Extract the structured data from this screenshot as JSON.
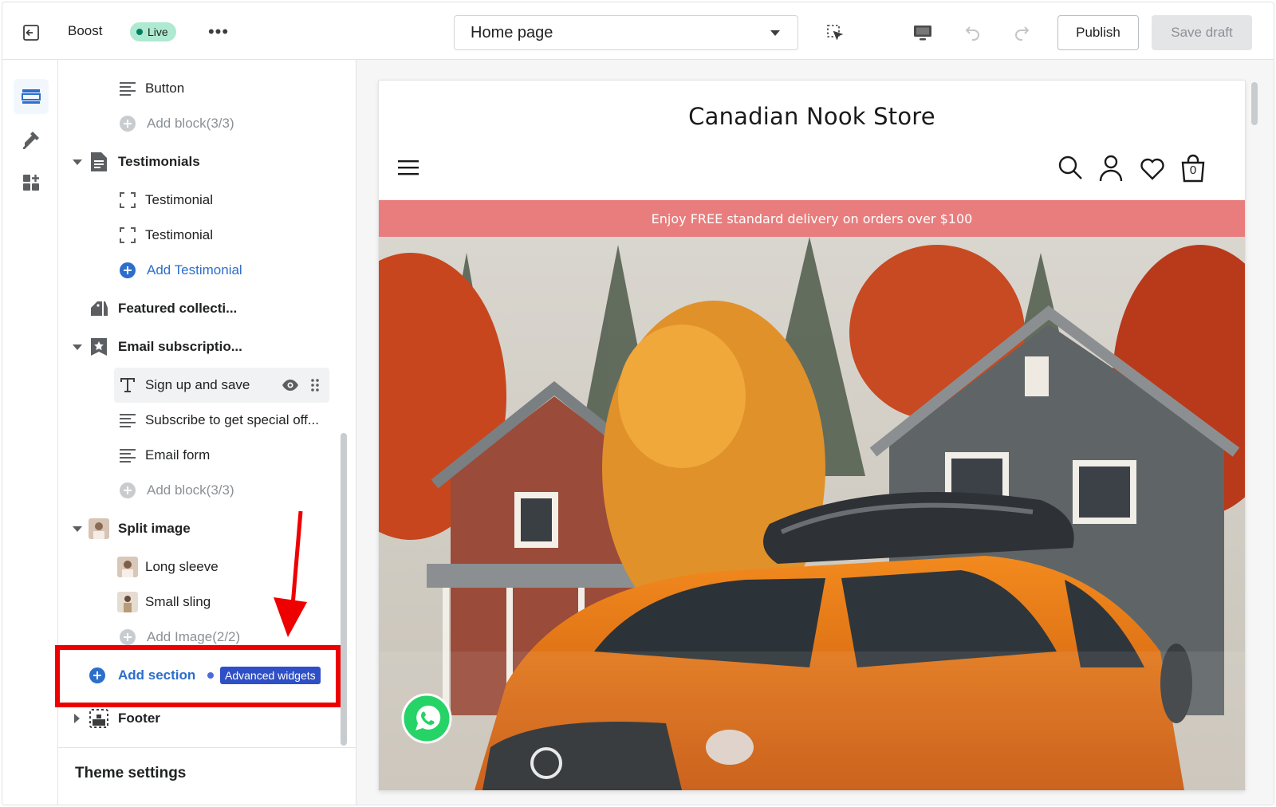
{
  "topbar": {
    "app_name": "Boost",
    "status_badge": "Live",
    "more_label": "•••",
    "page_selector": "Home page",
    "publish_label": "Publish",
    "save_draft_label": "Save draft",
    "icons": [
      "exit-icon",
      "inspect-icon",
      "desktop-icon",
      "undo-icon",
      "redo-icon"
    ]
  },
  "rail": {
    "items": [
      {
        "name": "sections-icon",
        "active": true
      },
      {
        "name": "theme-settings-icon",
        "active": false
      },
      {
        "name": "apps-icon",
        "active": false
      }
    ]
  },
  "sidebar": {
    "rows": [
      {
        "type": "block",
        "label": "Button",
        "icon": "text-lines-icon"
      },
      {
        "type": "add",
        "label": "Add block(3/3)"
      },
      {
        "type": "section",
        "label": "Testimonials",
        "icon": "document-icon",
        "expanded": true
      },
      {
        "type": "block",
        "label": "Testimonial",
        "icon": "frame-icon"
      },
      {
        "type": "block",
        "label": "Testimonial",
        "icon": "frame-icon"
      },
      {
        "type": "add-blue",
        "label": "Add Testimonial"
      },
      {
        "type": "section",
        "label": "Featured collecti...",
        "icon": "tags-icon"
      },
      {
        "type": "section",
        "label": "Email subscriptio...",
        "icon": "star-bookmark-icon",
        "expanded": true
      },
      {
        "type": "block-selected",
        "label": "Sign up and save",
        "icon": "text-t-icon"
      },
      {
        "type": "block",
        "label": "Subscribe to get special off...",
        "icon": "text-lines-icon"
      },
      {
        "type": "block",
        "label": "Email form",
        "icon": "text-lines-icon"
      },
      {
        "type": "add",
        "label": "Add block(3/3)"
      },
      {
        "type": "section",
        "label": "Split image",
        "icon": "image-thumb-icon",
        "expanded": true
      },
      {
        "type": "block",
        "label": "Long sleeve",
        "icon": "image-thumb-icon"
      },
      {
        "type": "block",
        "label": "Small sling",
        "icon": "image-thumb-icon"
      },
      {
        "type": "add",
        "label": "Add Image(2/2)"
      }
    ],
    "add_section_label": "Add section",
    "advanced_widgets_label": "Advanced widgets",
    "footer_label": "Footer",
    "theme_settings_label": "Theme settings"
  },
  "preview": {
    "store_name": "Canadian Nook Store",
    "announcement": "Enjoy FREE standard delivery on orders over $100",
    "cart_count": "0",
    "colors": {
      "announcement_bg": "#e97d7d",
      "accent": "#2c6ecb",
      "highlight_box": "#ee0000"
    }
  }
}
